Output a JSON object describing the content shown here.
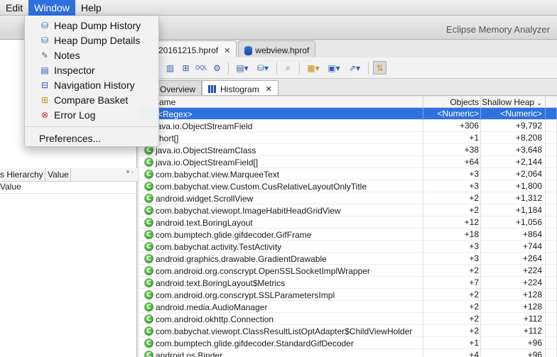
{
  "menubar": {
    "items": [
      "Edit",
      "Window",
      "Help"
    ],
    "active": "Window"
  },
  "window_title": "Eclipse Memory Analyzer",
  "window_menu": {
    "items": [
      {
        "label": "Heap Dump History",
        "icon": "history-icon"
      },
      {
        "label": "Heap Dump Details",
        "icon": "database-icon"
      },
      {
        "label": "Notes",
        "icon": "notes-icon"
      },
      {
        "label": "Inspector",
        "icon": "inspector-icon"
      },
      {
        "label": "Navigation History",
        "icon": "navigation-icon"
      },
      {
        "label": "Compare Basket",
        "icon": "basket-icon"
      },
      {
        "label": "Error Log",
        "icon": "error-log-icon"
      }
    ],
    "preferences": "Preferences..."
  },
  "left_panel": {
    "columns": [
      "s Hierarchy",
      "Value"
    ],
    "row": "Value"
  },
  "file_tabs": [
    {
      "label": "20161215.hprof",
      "active": true,
      "close": "✕"
    },
    {
      "label": "webview.hprof",
      "active": false
    }
  ],
  "view_tabs": [
    {
      "label": "Overview",
      "active": false
    },
    {
      "label": "Histogram",
      "active": true,
      "close": "✕"
    }
  ],
  "table": {
    "headers": {
      "name": "ss Name",
      "objects": "Objects",
      "shallow": "Shallow Heap"
    },
    "filter_row": {
      "name": "<Regex>",
      "objects": "<Numeric>",
      "shallow": "<Numeric>"
    },
    "rows": [
      {
        "name": "java.io.ObjectStreamField",
        "objects": "+306",
        "shallow": "+9,792",
        "icon": false
      },
      {
        "name": "short[]",
        "objects": "+1",
        "shallow": "+8,208",
        "icon": false
      },
      {
        "name": "java.io.ObjectStreamClass",
        "objects": "+38",
        "shallow": "+3,648",
        "icon": true
      },
      {
        "name": "java.io.ObjectStreamField[]",
        "objects": "+64",
        "shallow": "+2,144",
        "icon": true
      },
      {
        "name": "com.babychat.view.MarqueeText",
        "objects": "+3",
        "shallow": "+2,064",
        "icon": true
      },
      {
        "name": "com.babychat.view.Custom.CusRelativeLayoutOnlyTitle",
        "objects": "+3",
        "shallow": "+1,800",
        "icon": true
      },
      {
        "name": "android.widget.ScrollView",
        "objects": "+2",
        "shallow": "+1,312",
        "icon": true
      },
      {
        "name": "com.babychat.viewopt.ImageHabitHeadGridView",
        "objects": "+2",
        "shallow": "+1,184",
        "icon": true
      },
      {
        "name": "android.text.BoringLayout",
        "objects": "+12",
        "shallow": "+1,056",
        "icon": true
      },
      {
        "name": "com.bumptech.glide.gifdecoder.GifFrame",
        "objects": "+18",
        "shallow": "+864",
        "icon": true
      },
      {
        "name": "com.babychat.activity.TestActivity",
        "objects": "+3",
        "shallow": "+744",
        "icon": true
      },
      {
        "name": "android.graphics.drawable.GradientDrawable",
        "objects": "+3",
        "shallow": "+264",
        "icon": true
      },
      {
        "name": "com.android.org.conscrypt.OpenSSLSocketImplWrapper",
        "objects": "+2",
        "shallow": "+224",
        "icon": true
      },
      {
        "name": "android.text.BoringLayout$Metrics",
        "objects": "+7",
        "shallow": "+224",
        "icon": true
      },
      {
        "name": "com.android.org.conscrypt.SSLParametersImpl",
        "objects": "+2",
        "shallow": "+128",
        "icon": true
      },
      {
        "name": "android.media.AudioManager",
        "objects": "+2",
        "shallow": "+128",
        "icon": true
      },
      {
        "name": "com.android.okhttp.Connection",
        "objects": "+2",
        "shallow": "+112",
        "icon": true
      },
      {
        "name": "com.babychat.viewopt.ClassResultListOptAdapter$ChildViewHolder",
        "objects": "+2",
        "shallow": "+112",
        "icon": true
      },
      {
        "name": "com.bumptech.glide.gifdecoder.StandardGifDecoder",
        "objects": "+1",
        "shallow": "+96",
        "icon": true
      },
      {
        "name": "android.os.Binder",
        "objects": "+4",
        "shallow": "+96",
        "icon": true
      }
    ]
  },
  "colors": {
    "selection": "#2f72dd",
    "menu_highlight": "#2f6fde",
    "class_icon": "#3d9b34"
  }
}
